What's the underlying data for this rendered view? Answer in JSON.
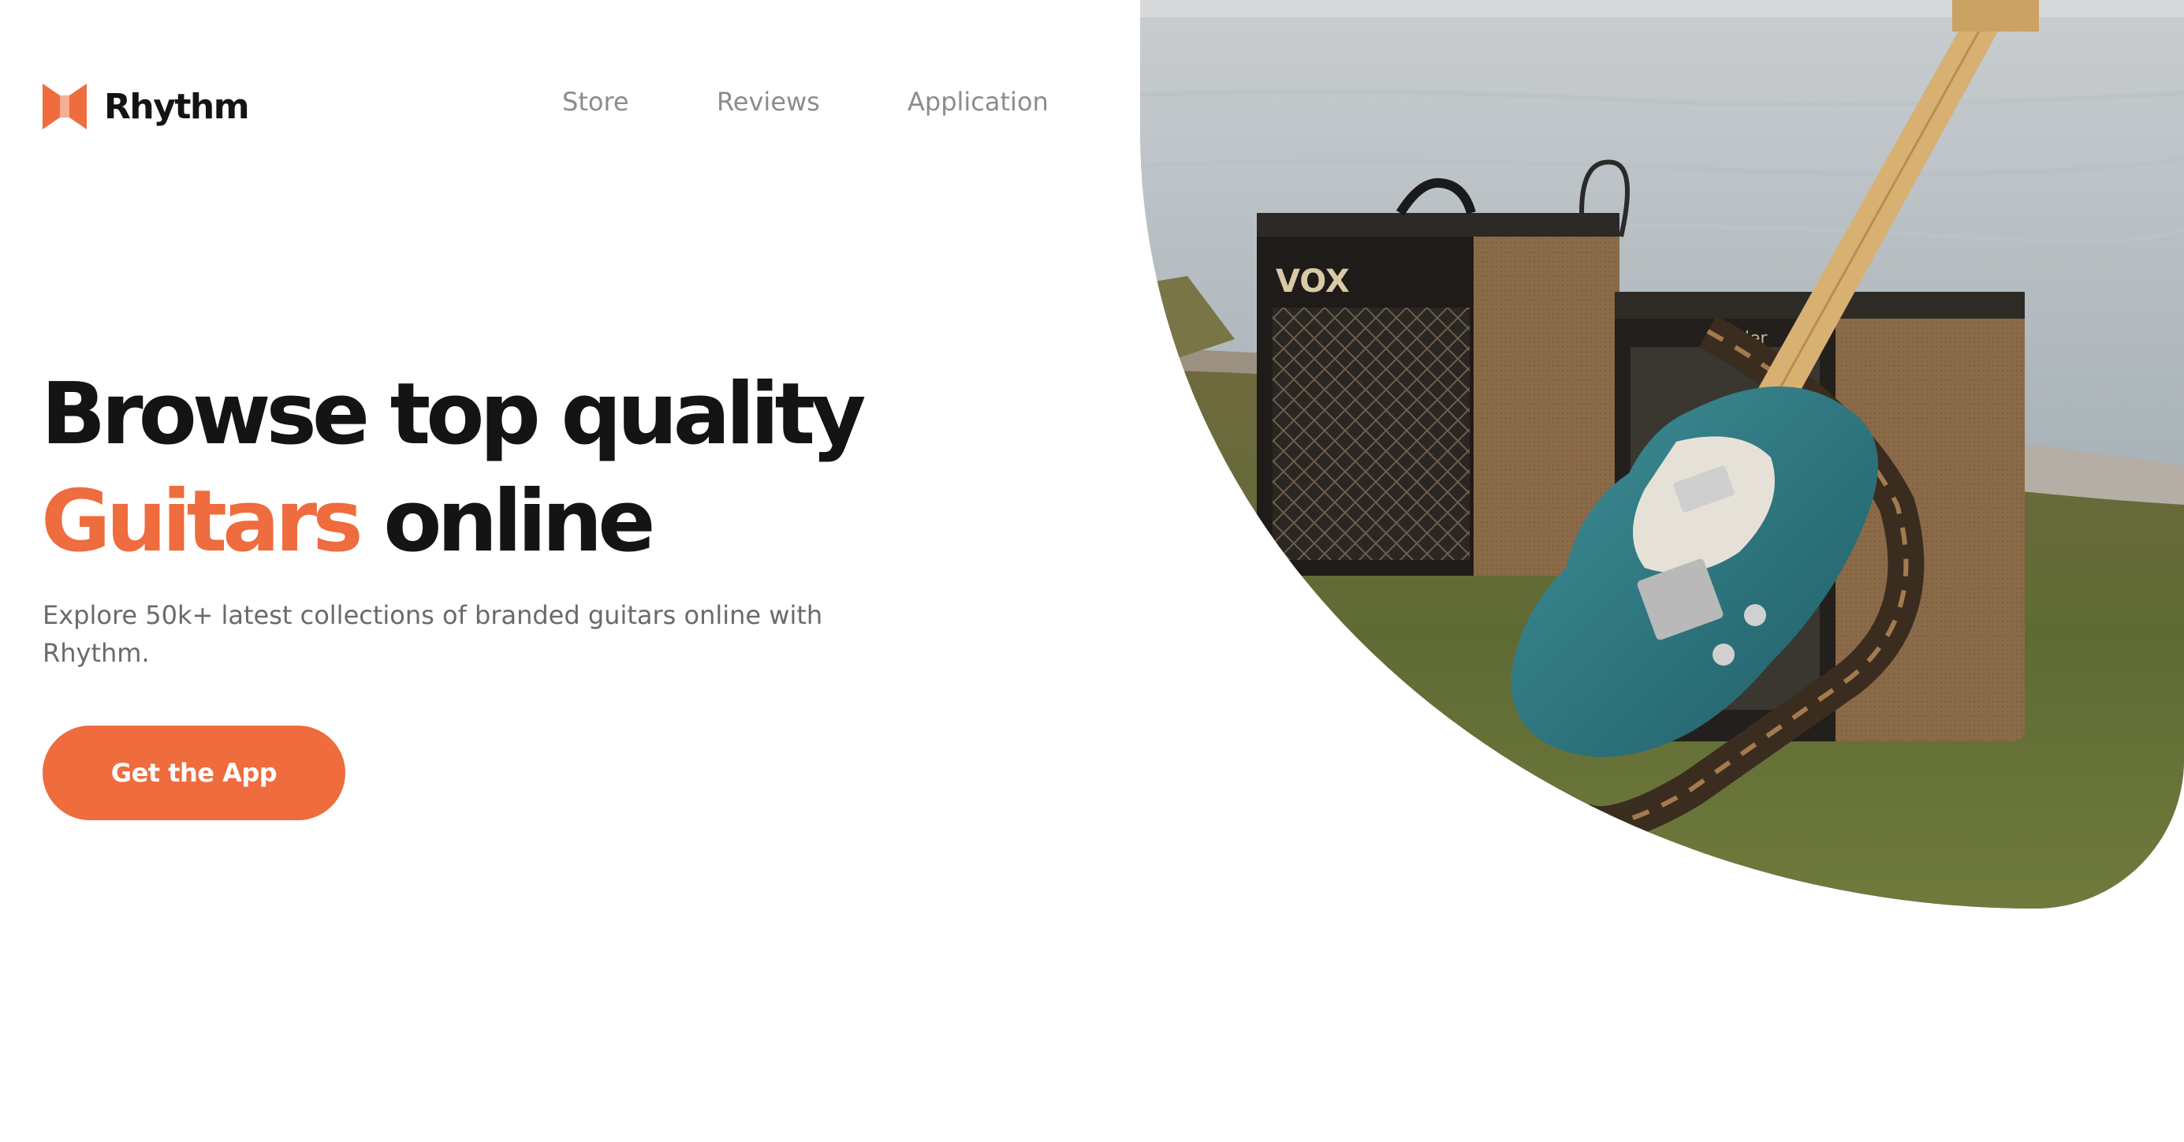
{
  "brand": {
    "name": "Rhythm",
    "logo_icon": "bowtie-logo-icon",
    "accent_color": "#EE6C3D"
  },
  "nav": {
    "items": [
      {
        "label": "Store"
      },
      {
        "label": "Reviews"
      },
      {
        "label": "Application"
      }
    ]
  },
  "hero": {
    "headline_line1": "Browse top quality",
    "headline_accent": "Guitars",
    "headline_line2_rest": " online",
    "subtext": "Explore 50k+ latest collections of branded guitars online with Rhythm.",
    "cta_label": "Get the App",
    "image": {
      "subject": "teal electric guitar leaning against two amplifiers on grass by the sea",
      "amp_left_label": "VOX",
      "amp_right_label": "Fender"
    }
  }
}
